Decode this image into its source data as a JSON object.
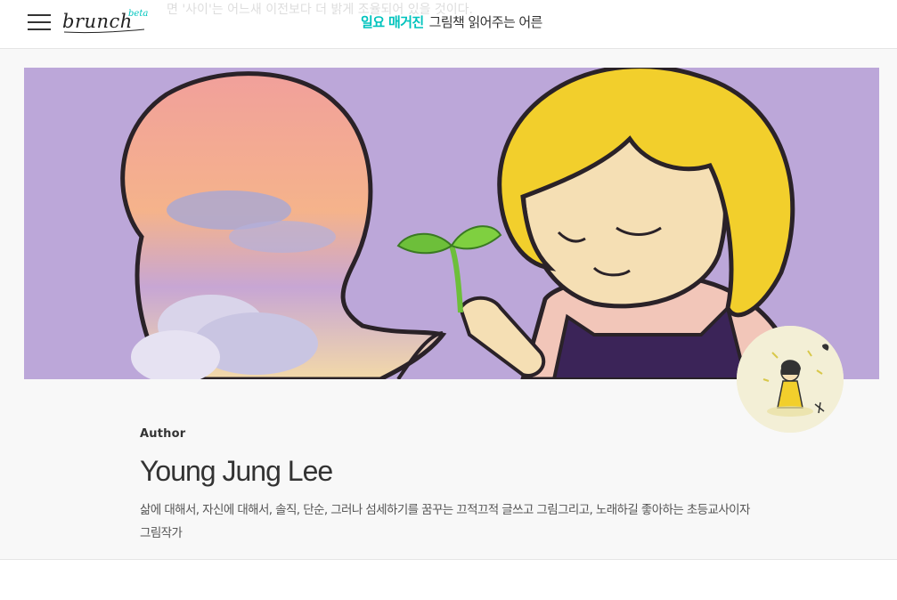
{
  "header": {
    "ghost_text": "면 '사이'는 어느새 이전보다 더 밝게 조율되어 있을 것이다.",
    "menu_icon": "hamburger-menu-icon",
    "logo_text": "brunch",
    "logo_badge": "beta",
    "magazine_label": "일요 매거진",
    "book_title": "그림책 읽어주는 어른"
  },
  "profile": {
    "label": "Author",
    "name": "Young Jung Lee",
    "bio": "삶에 대해서, 자신에 대해서, 솔직, 단순, 그러나 섬세하기를 꿈꾸는 끄적끄적 글쓰고 그림그리고, 노래하길 좋아하는 초등교사이자 그림작가"
  },
  "colors": {
    "accent": "#00c3bd",
    "cover_bg": "#b7a2d7",
    "hair": "#f2cf2c",
    "sprout": "#6dbf3a"
  }
}
